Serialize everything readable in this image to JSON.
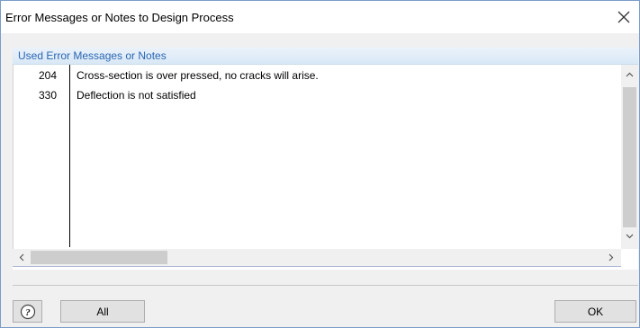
{
  "window": {
    "title": "Error Messages or Notes to Design Process",
    "close_glyph": "✕"
  },
  "group": {
    "header": "Used Error Messages or Notes"
  },
  "messages": [
    {
      "code": "204",
      "text": "Cross-section is over pressed, no cracks will arise."
    },
    {
      "code": "330",
      "text": "Deflection is not satisfied"
    }
  ],
  "scrollbars": {
    "up_glyph": "^",
    "down_glyph": "v",
    "left_glyph": "<",
    "right_glyph": ">"
  },
  "footer": {
    "help_icon": "help-icon",
    "all_label": "All",
    "ok_label": "OK"
  },
  "colors": {
    "header_text": "#2a66b3",
    "window_border": "#7a9cc8"
  }
}
